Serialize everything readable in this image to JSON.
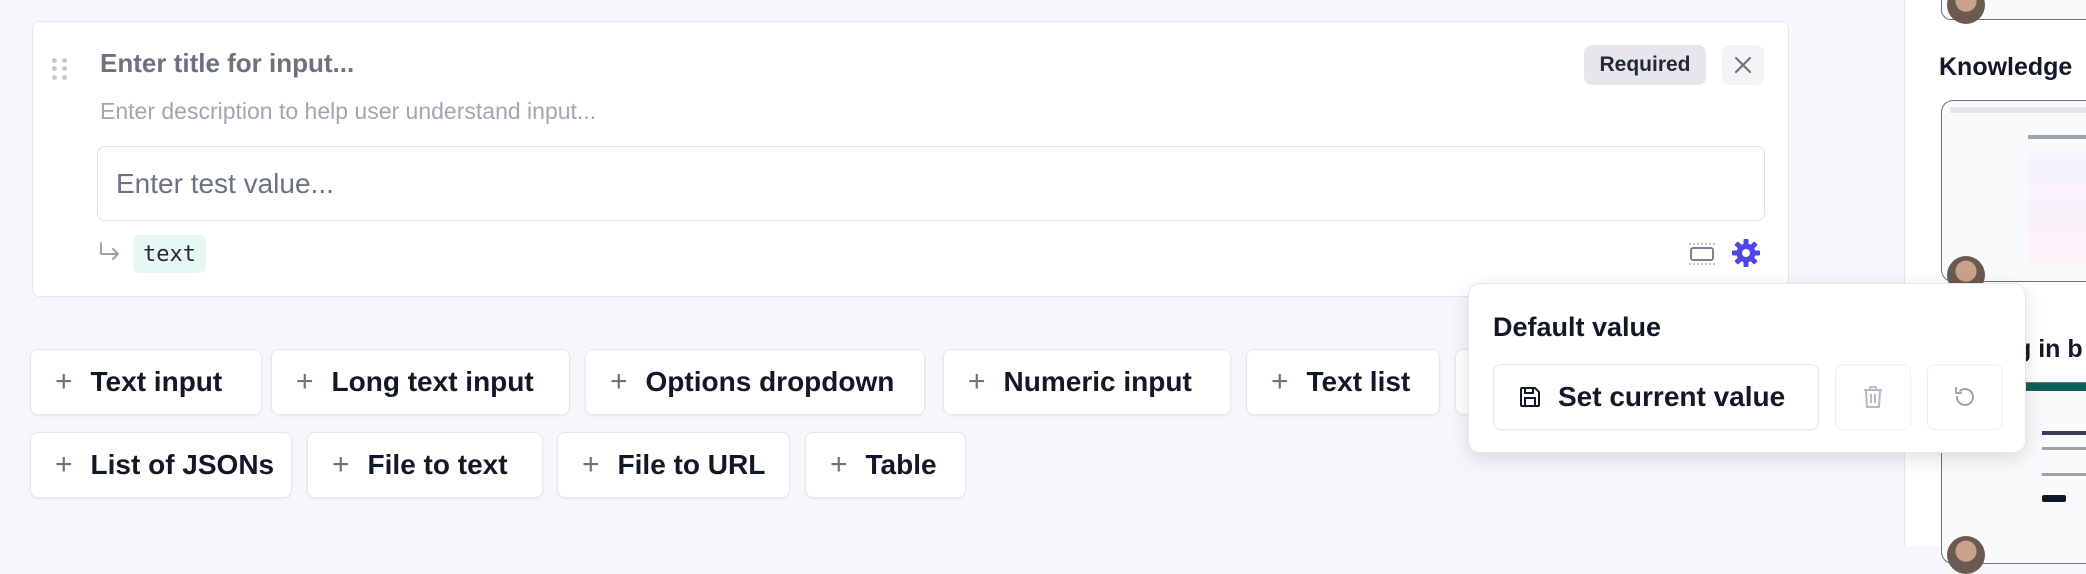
{
  "input_card": {
    "title_placeholder": "Enter title for input...",
    "description_placeholder": "Enter description to help user understand input...",
    "required_label": "Required",
    "test_value_placeholder": "Enter test value...",
    "type_tag": "text"
  },
  "add_input_buttons": [
    "Text input",
    "Long text input",
    "Options dropdown",
    "Numeric input",
    "Text list",
    "List of JSONs",
    "File to text",
    "File to URL",
    "Table"
  ],
  "popover": {
    "title": "Default value",
    "set_current_value_label": "Set current value"
  },
  "right_panel": {
    "heading_1": "Knowledge",
    "heading_2_partial": "g in b"
  },
  "colors": {
    "accent": "#4f46e5",
    "type_tag_bg": "#e6f8f2"
  },
  "icons": [
    "drag-handle-icon",
    "close-icon",
    "return-arrow-icon",
    "layout-icon",
    "gear-icon",
    "plus-icon",
    "save-icon",
    "trash-icon",
    "reset-icon"
  ]
}
